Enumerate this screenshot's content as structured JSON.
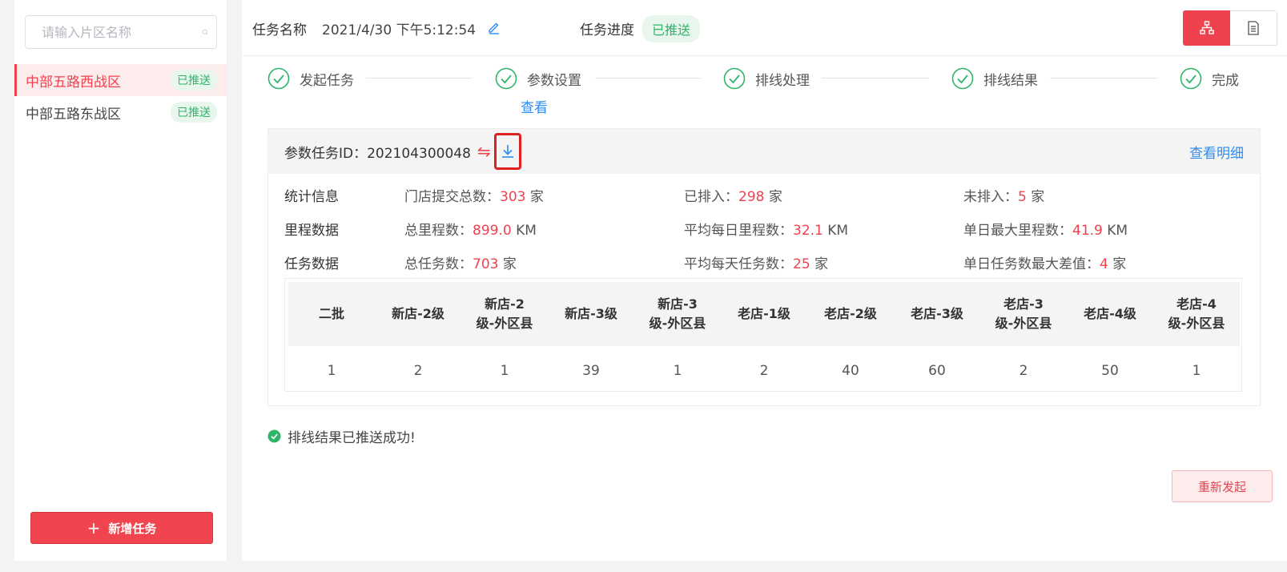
{
  "sidebar": {
    "search_placeholder": "请输入片区名称",
    "regions": [
      {
        "name": "中部五路西战区",
        "status": "已推送"
      },
      {
        "name": "中部五路东战区",
        "status": "已推送"
      }
    ],
    "add_task_label": "新增任务"
  },
  "header": {
    "task_name_label": "任务名称",
    "task_name_value": "2021/4/30 下午5:12:54",
    "progress_label": "任务进度",
    "progress_value": "已推送"
  },
  "steps": {
    "items": [
      "发起任务",
      "参数设置",
      "排线处理",
      "排线结果",
      "完成"
    ],
    "view_link": "查看"
  },
  "param_card": {
    "title": "参数任务ID：202104300048",
    "detail_link": "查看明细",
    "rows": [
      {
        "label": "统计信息",
        "cells": [
          {
            "prefix": "门店提交总数：",
            "num": "303",
            "unit": "家"
          },
          {
            "prefix": "已排入：",
            "num": "298",
            "unit": "家"
          },
          {
            "prefix": "未排入：",
            "num": "5",
            "unit": "家"
          }
        ]
      },
      {
        "label": "里程数据",
        "cells": [
          {
            "prefix": "总里程数：",
            "num": "899.0",
            "unit": "KM"
          },
          {
            "prefix": "平均每日里程数：",
            "num": "32.1",
            "unit": "KM"
          },
          {
            "prefix": "单日最大里程数：",
            "num": "41.9",
            "unit": "KM"
          }
        ]
      },
      {
        "label": "任务数据",
        "cells": [
          {
            "prefix": "总任务数：",
            "num": "703",
            "unit": "家"
          },
          {
            "prefix": "平均每天任务数：",
            "num": "25",
            "unit": "家"
          },
          {
            "prefix": "单日任务数最大差值：",
            "num": "4",
            "unit": "家"
          }
        ]
      }
    ],
    "table": {
      "headers": [
        "二批",
        "新店-2级",
        "新店-2\n级-外区县",
        "新店-3级",
        "新店-3\n级-外区县",
        "老店-1级",
        "老店-2级",
        "老店-3级",
        "老店-3\n级-外区县",
        "老店-4级",
        "老店-4\n级-外区县"
      ],
      "values": [
        "1",
        "2",
        "1",
        "39",
        "1",
        "2",
        "40",
        "60",
        "2",
        "50",
        "1"
      ]
    }
  },
  "success_message": "排线结果已推送成功!",
  "restart_label": "重新发起",
  "colors": {
    "accent": "#f0414f",
    "success": "#2fb56a",
    "link": "#2d8cf0"
  }
}
